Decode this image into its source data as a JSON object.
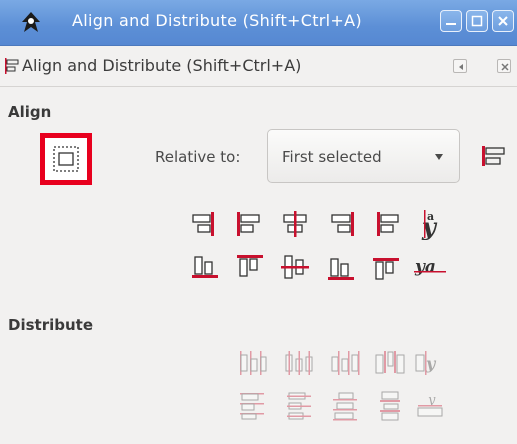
{
  "window": {
    "title": "Align and Distribute (Shift+Ctrl+A)"
  },
  "panel": {
    "title": "Align and Distribute (Shift+Ctrl+A)"
  },
  "align": {
    "section_label": "Align",
    "relative_label": "Relative to:",
    "relative_value": "First selected",
    "row1_icons": [
      "align-right-edges-to-left-icon",
      "align-left-edges-icon",
      "center-on-vertical-axis-icon",
      "align-right-edges-icon",
      "align-left-edges-to-right-icon",
      "align-baseline-text-vertical-icon"
    ],
    "row2_icons": [
      "align-bottom-to-top-icon",
      "align-top-edges-icon",
      "center-on-horizontal-axis-icon",
      "align-bottom-edges-icon",
      "align-top-to-bottom-icon",
      "align-baseline-text-horizontal-icon"
    ]
  },
  "distribute": {
    "section_label": "Distribute"
  },
  "colors": {
    "titlebar": "#5c8fd6",
    "highlight": "#e8001e",
    "icon_red": "#c8102e",
    "icon_dark": "#333333",
    "panel_bg": "#f2f1f0"
  }
}
